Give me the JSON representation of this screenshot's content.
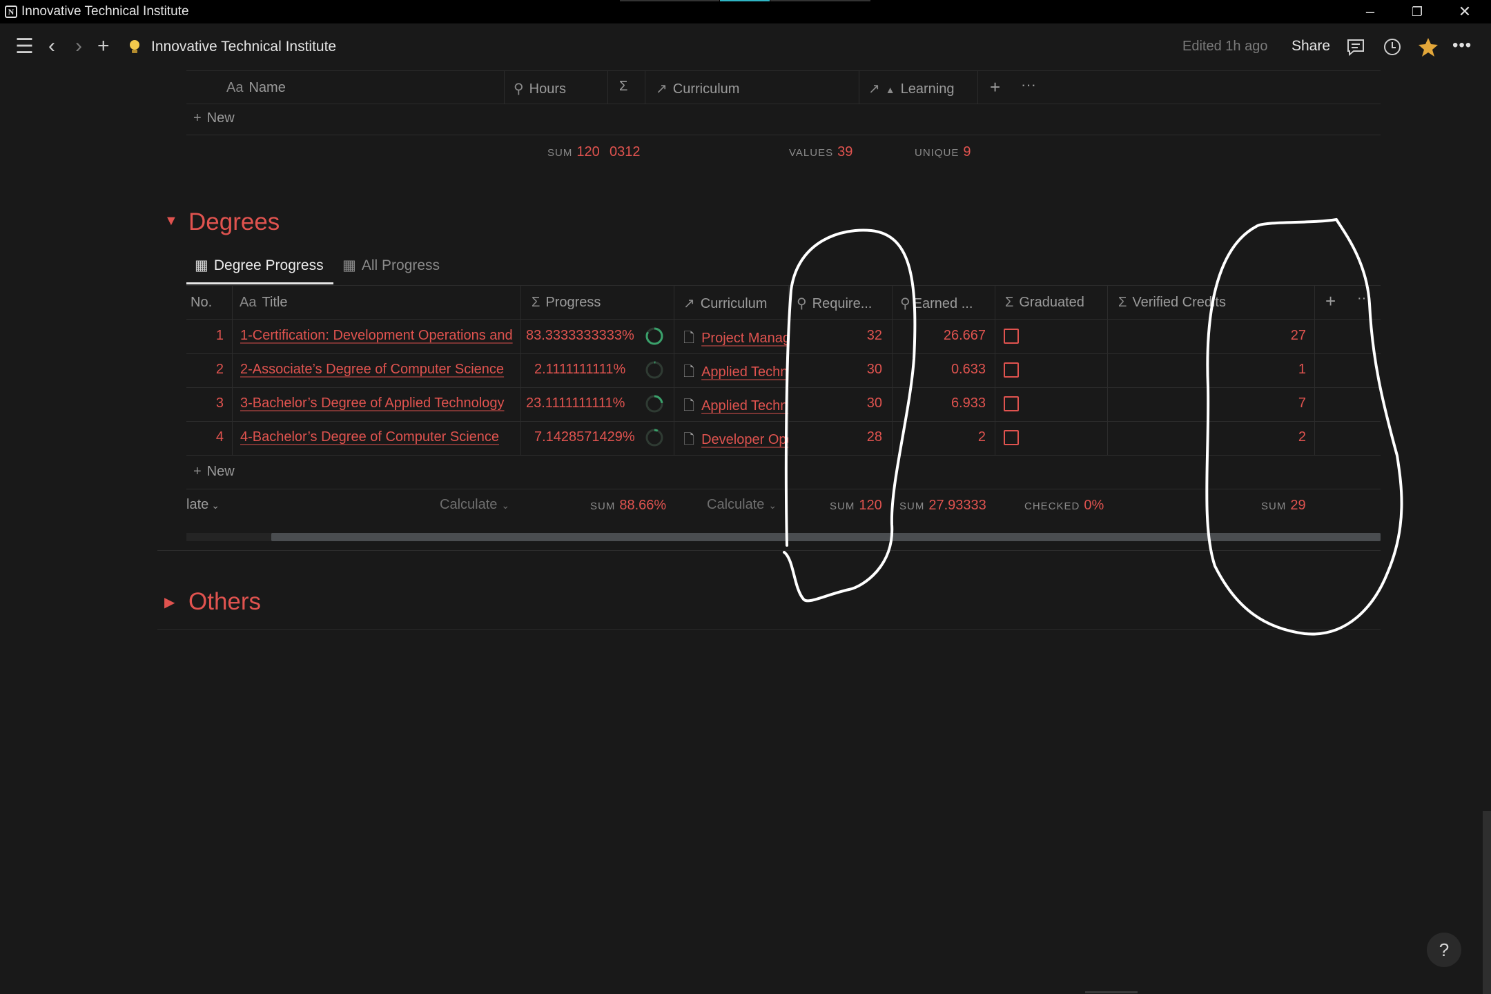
{
  "window": {
    "title": "Innovative Technical Institute",
    "minimize_icon": "minimize-icon",
    "restore_icon": "restore-icon",
    "close_icon": "close-icon"
  },
  "topbar": {
    "page_title": "Innovative Technical Institute",
    "edited": "Edited 1h ago",
    "share": "Share",
    "more": "•••"
  },
  "top_table": {
    "columns": [
      {
        "icon": "Aa",
        "label": "Name"
      },
      {
        "icon": "search-icon",
        "label": "Hours"
      },
      {
        "icon": "sigma-icon",
        "label": ""
      },
      {
        "icon": "relation-arrow-icon",
        "label": "Curriculum"
      },
      {
        "icon": "relation-arrow-icon",
        "label": "Learning"
      }
    ],
    "new_label": "New",
    "footer": {
      "hours_label": "SUM",
      "hours_value": "120",
      "sigma_value": "0312",
      "curriculum_label": "VALUES",
      "curriculum_value": "39",
      "learning_label": "UNIQUE",
      "learning_value": "9"
    }
  },
  "degrees": {
    "section_title": "Degrees",
    "tabs": [
      "Degree Progress",
      "All Progress"
    ],
    "columns": {
      "no": "No.",
      "title": "Title",
      "title_icon": "Aa",
      "progress": "Progress",
      "curriculum": "Curriculum",
      "required": "Require...",
      "earned": "Earned ...",
      "graduated": "Graduated",
      "verified": "Verified Credits"
    },
    "rows": [
      {
        "no": "1",
        "title": "1-Certification: Development Operations and",
        "progress": "83.3333333333%",
        "curriculum": "Project Management",
        "required": "32",
        "earned": "26.667",
        "verified": "27"
      },
      {
        "no": "2",
        "title": "2-Associate’s Degree of Computer Science",
        "progress": "2.1111111111%",
        "curriculum": "Applied Technology",
        "required": "30",
        "earned": "0.633",
        "verified": "1"
      },
      {
        "no": "3",
        "title": "3-Bachelor’s Degree of Applied Technology",
        "progress": "23.1111111111%",
        "curriculum": "Applied Technology",
        "required": "30",
        "earned": "6.933",
        "verified": "7"
      },
      {
        "no": "4",
        "title": "4-Bachelor’s Degree of Computer Science",
        "progress": "7.1428571429%",
        "curriculum": "Developer Operations",
        "required": "28",
        "earned": "2",
        "verified": "2"
      }
    ],
    "new_label": "New",
    "footer": {
      "first": "late",
      "title_calc": "Calculate",
      "progress_label": "SUM",
      "progress_value": "88.66%",
      "curriculum_calc": "Calculate",
      "required_label": "SUM",
      "required_value": "120",
      "earned_label": "SUM",
      "earned_value": "27.93333",
      "graduated_label": "CHECKED",
      "graduated_value": "0%",
      "verified_label": "SUM",
      "verified_value": "29"
    }
  },
  "others": {
    "section_title": "Others"
  },
  "help": "?",
  "colors": {
    "accent": "#e0534f",
    "background": "#191919",
    "ring_green": "#2e8b57"
  }
}
